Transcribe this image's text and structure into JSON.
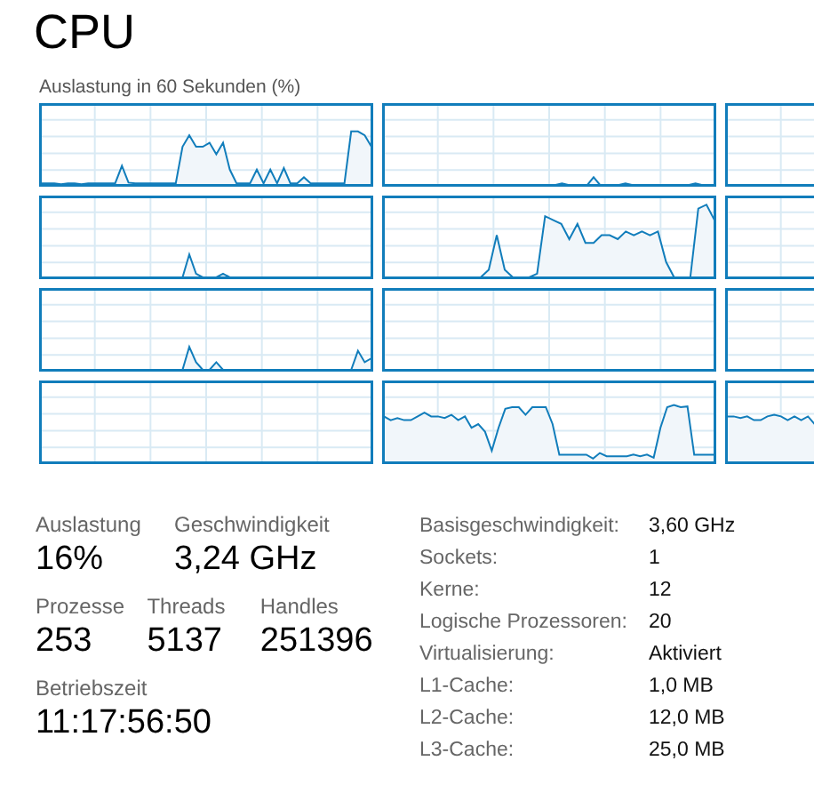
{
  "title": "CPU",
  "graph_caption": "Auslastung in 60 Sekunden (%)",
  "stat_rows": [
    [
      {
        "label": "Auslastung",
        "value": "16%"
      },
      {
        "label": "Geschwindigkeit",
        "value": "3,24 GHz"
      }
    ],
    [
      {
        "label": "Prozesse",
        "value": "253"
      },
      {
        "label": "Threads",
        "value": "5137"
      },
      {
        "label": "Handles",
        "value": "251396"
      }
    ],
    [
      {
        "label": "Betriebszeit",
        "value": "11:17:56:50"
      }
    ]
  ],
  "details": [
    {
      "label": "Basisgeschwindigkeit:",
      "value": "3,60 GHz"
    },
    {
      "label": "Sockets:",
      "value": "1"
    },
    {
      "label": "Kerne:",
      "value": "12"
    },
    {
      "label": "Logische Prozessoren:",
      "value": "20"
    },
    {
      "label": "Virtualisierung:",
      "value": "Aktiviert"
    },
    {
      "label": "L1-Cache:",
      "value": "1,0 MB"
    },
    {
      "label": "L2-Cache:",
      "value": "12,0 MB"
    },
    {
      "label": "L3-Cache:",
      "value": "25,0 MB"
    }
  ]
}
